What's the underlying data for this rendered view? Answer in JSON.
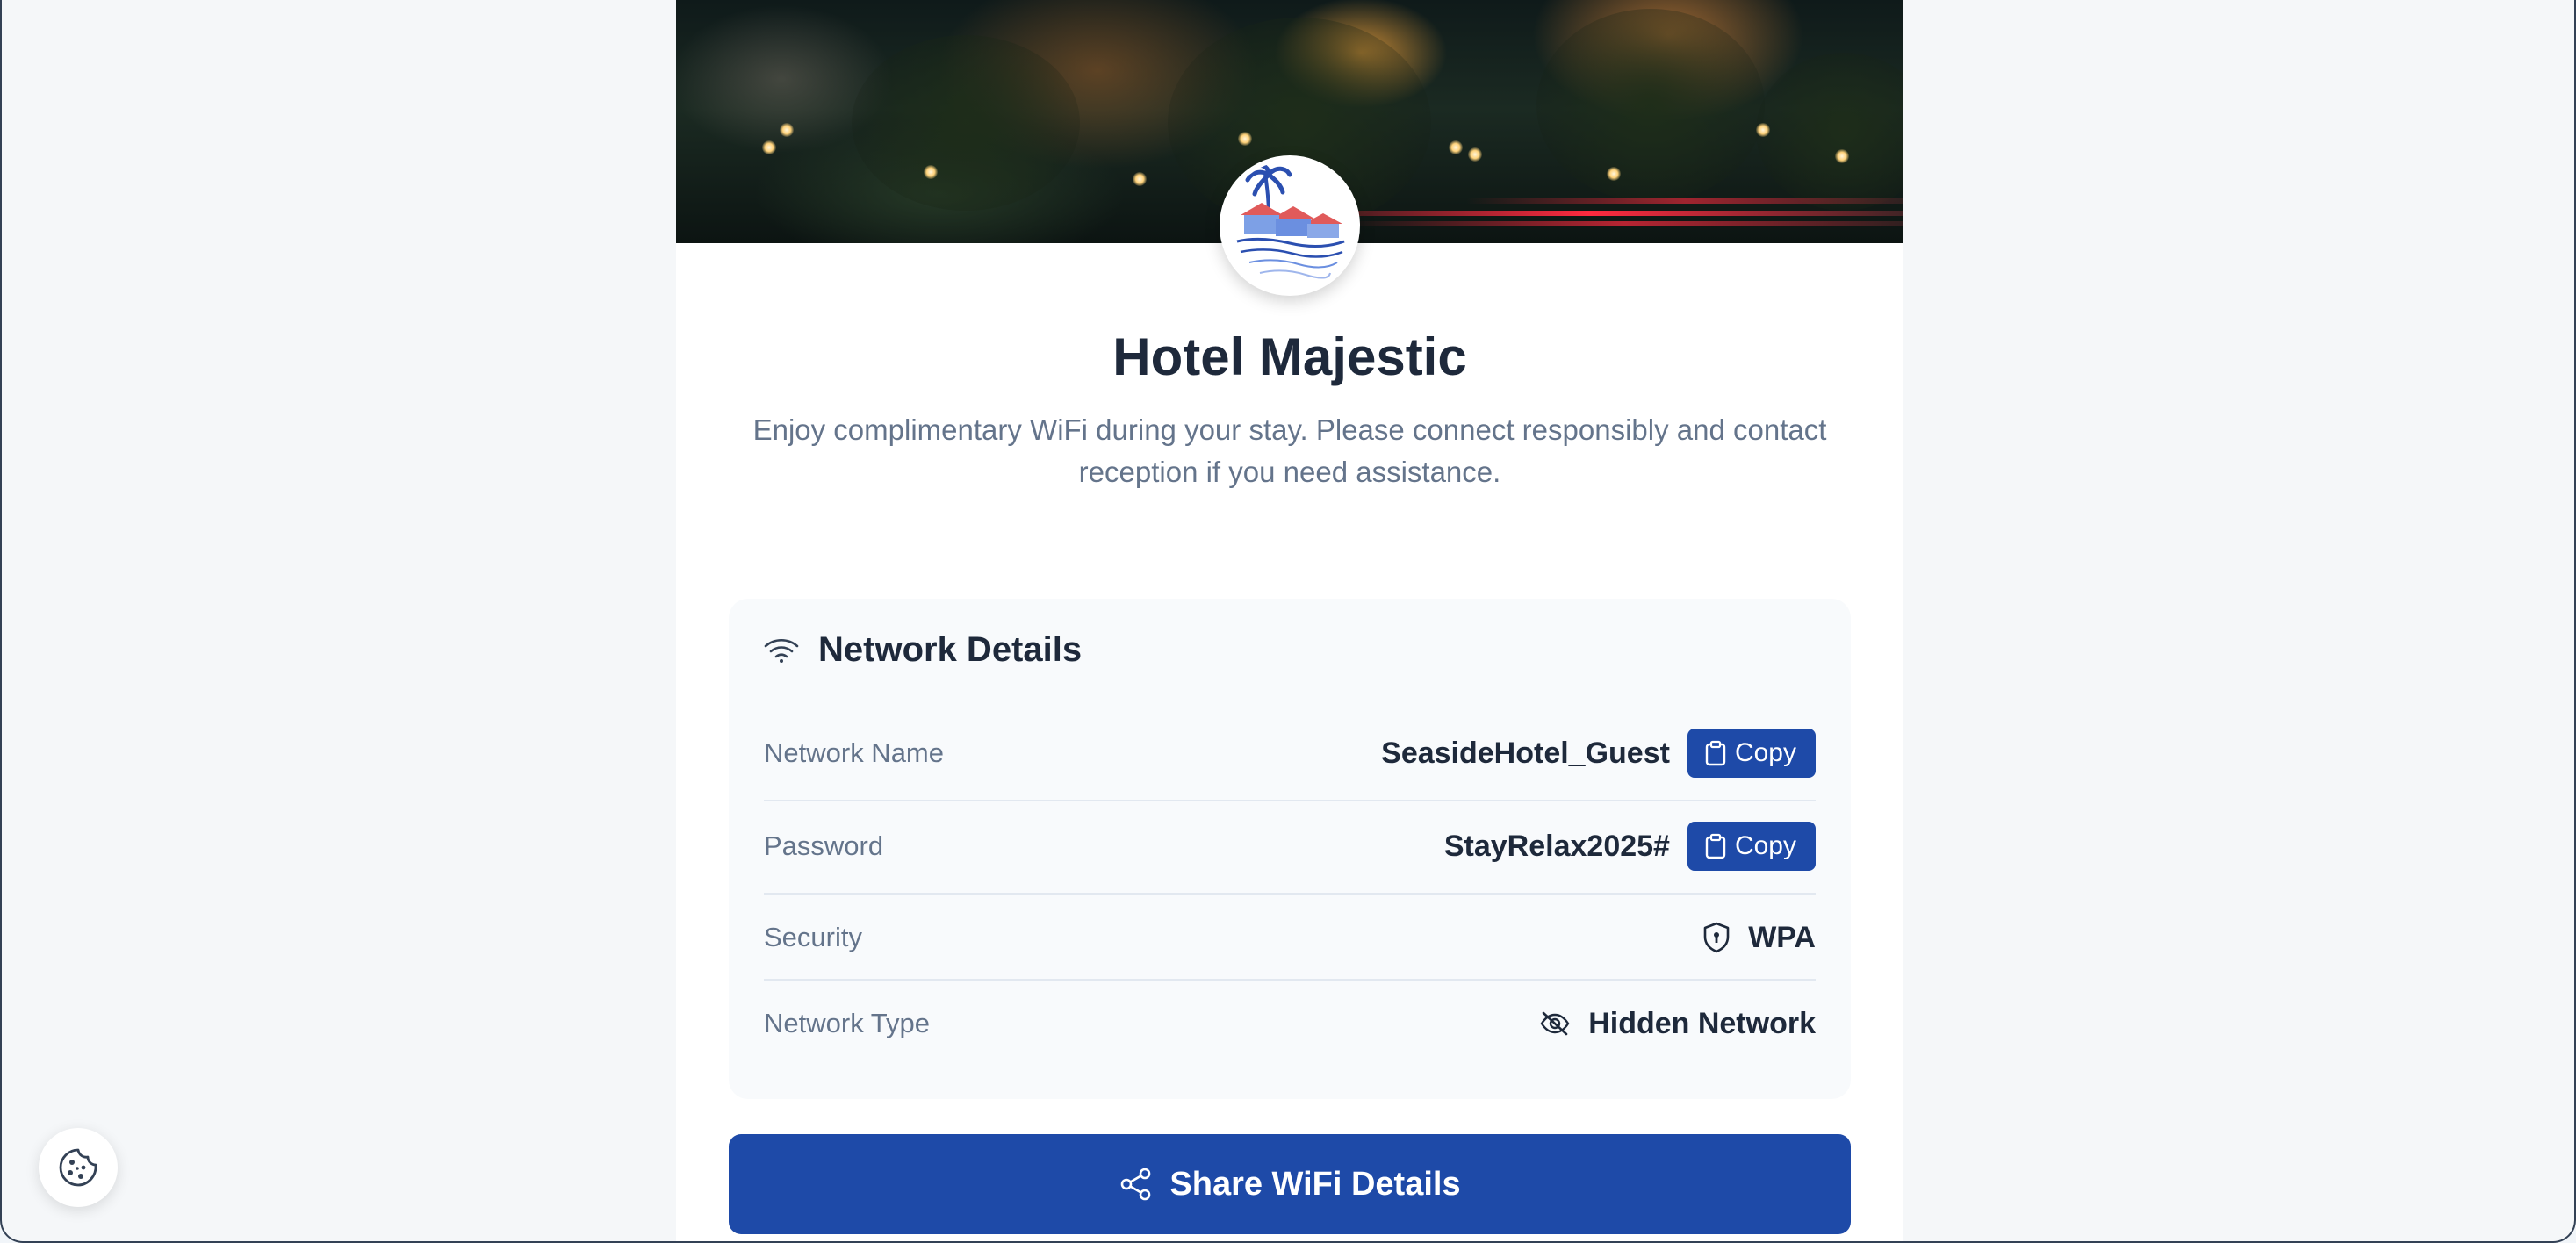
{
  "hotel": {
    "name": "Hotel Majestic",
    "description": "Enjoy complimentary WiFi during your stay. Please connect responsibly and contact reception if you need assistance.",
    "logo_icon": "beach-resort-logo"
  },
  "network_details": {
    "heading": "Network Details",
    "heading_icon": "wifi-icon",
    "rows": [
      {
        "label": "Network Name",
        "value": "SeasideHotel_Guest",
        "action": "Copy",
        "action_icon": "clipboard-icon"
      },
      {
        "label": "Password",
        "value": "StayRelax2025#",
        "action": "Copy",
        "action_icon": "clipboard-icon"
      },
      {
        "label": "Security",
        "value": "WPA",
        "icon": "shield-icon"
      },
      {
        "label": "Network Type",
        "value": "Hidden Network",
        "icon": "eye-off-icon"
      }
    ]
  },
  "share": {
    "label": "Share WiFi Details",
    "icon": "share-icon"
  },
  "cookie": {
    "icon": "cookie-icon"
  },
  "colors": {
    "primary": "#1e4aa8",
    "heading": "#1e293b",
    "muted": "#64748b",
    "panel": "#f8fafc"
  }
}
